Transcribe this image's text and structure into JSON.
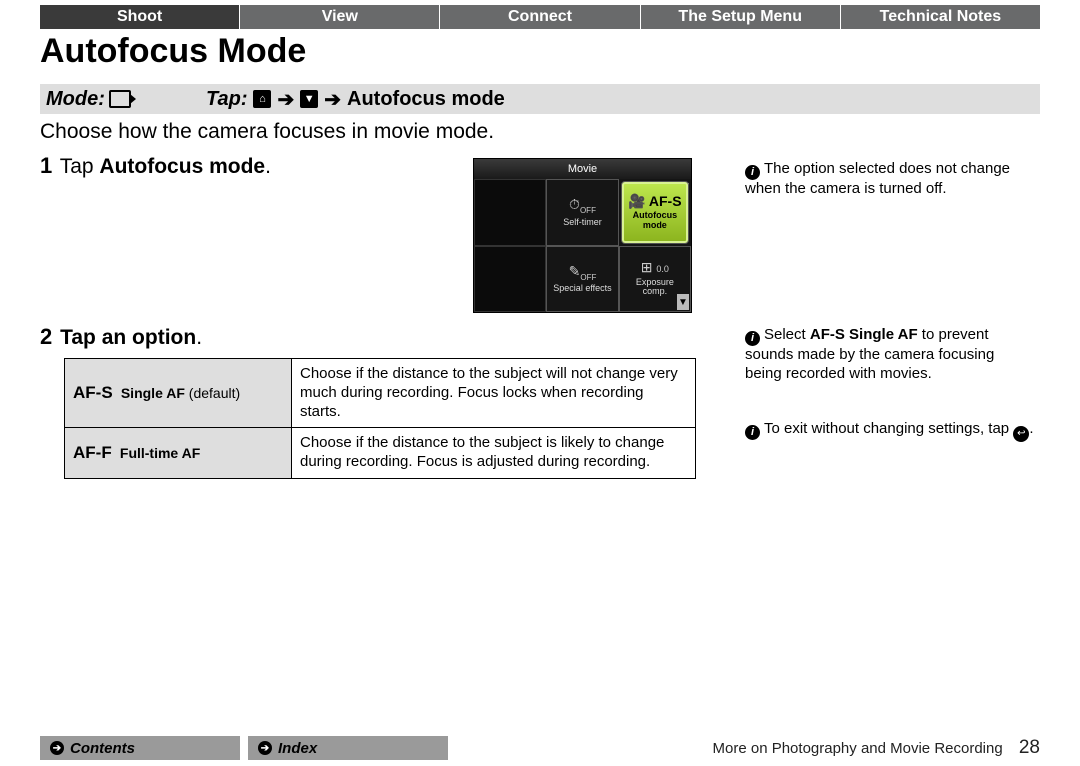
{
  "tabs": {
    "items": [
      {
        "label": "Shoot",
        "active": true
      },
      {
        "label": "View",
        "active": false
      },
      {
        "label": "Connect",
        "active": false
      },
      {
        "label": "The Setup Menu",
        "active": false
      },
      {
        "label": "Technical Notes",
        "active": false
      }
    ]
  },
  "title": "Autofocus Mode",
  "modebar": {
    "mode_label": "Mode:",
    "tap_label": "Tap:",
    "arrow": "➔",
    "destination": "Autofocus mode"
  },
  "intro": "Choose how the camera focuses in movie mode.",
  "steps": {
    "s1_num": "1",
    "s1_text_prefix": "Tap ",
    "s1_text_strong": "Autofocus mode",
    "s1_text_suffix": ".",
    "s2_num": "2",
    "s2_text_strong": "Tap an option",
    "s2_text_suffix": "."
  },
  "shot": {
    "title": "Movie",
    "cells": {
      "c0_icon": "⏱",
      "c0_status": "OFF",
      "c0_label": "Self-timer",
      "c1_icon": "🎥 AF-S",
      "c1_label1": "Autofocus",
      "c1_label2": "mode",
      "c2_icon": "✎",
      "c2_status": "OFF",
      "c2_label": "Special effects",
      "c3_icon": "⊞",
      "c3_status": "0.0",
      "c3_label1": "Exposure",
      "c3_label2": "comp."
    }
  },
  "af_table": {
    "rows": [
      {
        "code": "AF-S",
        "name": "Single AF",
        "default": " (default)",
        "desc": "Choose if the distance to the subject will not change very much during recording. Focus locks when recording starts."
      },
      {
        "code": "AF-F",
        "name": "Full-time AF",
        "default": "",
        "desc": "Choose if the distance to the subject is likely to change during recording. Focus is adjusted during recording."
      }
    ]
  },
  "notes": {
    "n1": "The option selected does not change when the camera is turned off.",
    "n2_pre": "Select ",
    "n2_code": "AF-S",
    "n2_name": " Single AF",
    "n2_post": " to prevent sounds made by the camera focusing being recorded with movies.",
    "n3_pre": "To exit without changing settings, tap ",
    "n3_post": "."
  },
  "footer": {
    "contents": "Contents",
    "index": "Index",
    "breadcrumb": "More on Photography and Movie Recording",
    "page": "28"
  }
}
